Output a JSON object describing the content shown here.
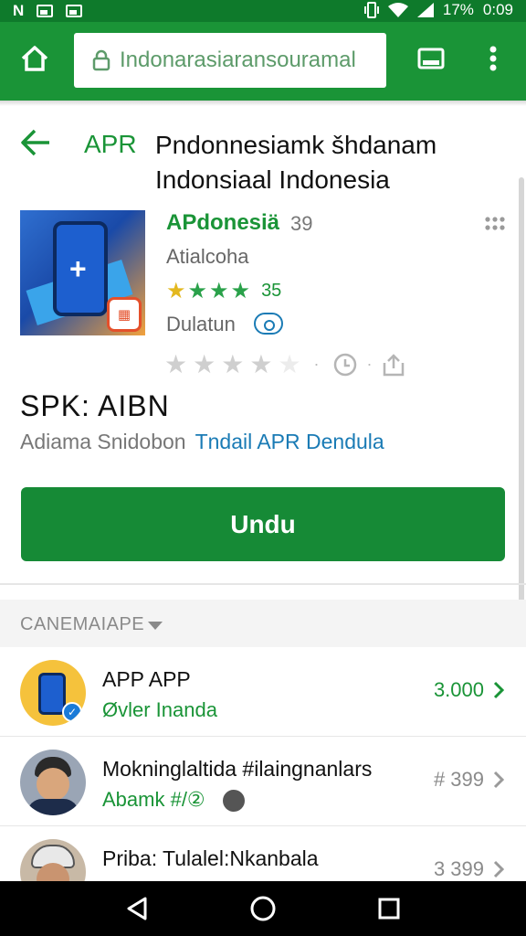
{
  "status_bar": {
    "left_letter": "N",
    "battery": "17%",
    "time": "0:09"
  },
  "browser": {
    "url": "Indonarasiaransouramal"
  },
  "header": {
    "back_label": "APR",
    "title": "Pndonnesiamk šhdanam Indonsiaal Indonesia"
  },
  "app": {
    "name": "APdonesiä",
    "name_count": "39",
    "developer": "Atialcoha",
    "rating_count": "35",
    "status": "Dulatun",
    "stars_filled": 4,
    "stars_total": 5
  },
  "section": {
    "title": "SPK: AIBN",
    "subtitle_muted": "Adiama Snidobon",
    "subtitle_link": "Tndail APR Dendula"
  },
  "download_button": {
    "label": "Undu"
  },
  "list": {
    "header": "CANEMAIAPE",
    "items": [
      {
        "title": "APP APP",
        "subtitle": "Øvler Inanda",
        "value": "3.000",
        "value_color": "green"
      },
      {
        "title": "Mokninglaltida  #ilaingnanlars",
        "subtitle": "Abamk #/②",
        "value": "# 399",
        "value_color": "gray"
      },
      {
        "title": "Priba: Tulalel:Nkanbala",
        "subtitle": "",
        "value": "3 399",
        "value_color": "gray"
      }
    ]
  },
  "colors": {
    "brand_green": "#1a9437",
    "status_green": "#0e7a2b",
    "button_green": "#168a36",
    "link_blue": "#1a7bb5"
  },
  "icons": [
    "home-icon",
    "lock-icon",
    "tabs-icon",
    "overflow-menu-icon",
    "back-arrow-icon",
    "more-grid-icon",
    "star-icon",
    "clock-icon",
    "share-icon",
    "chevron-right-icon",
    "nav-back-icon",
    "nav-home-icon",
    "nav-recents-icon"
  ]
}
